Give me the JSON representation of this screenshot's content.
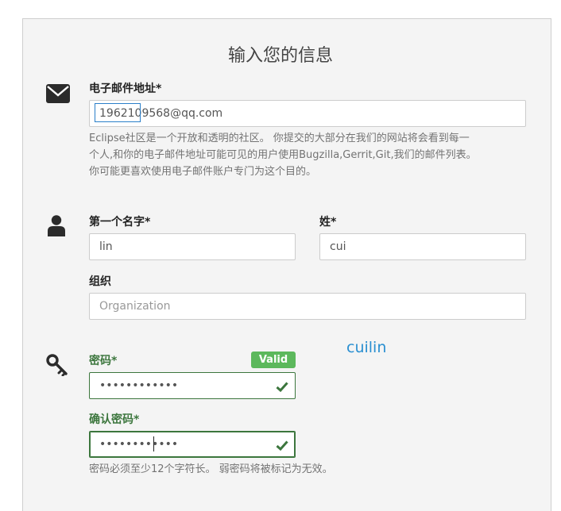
{
  "form": {
    "title": "输入您的信息",
    "email": {
      "label": "电子邮件地址*",
      "value": "1962109568@qq.com",
      "help": [
        "Eclipse社区是一个开放和透明的社区。 你提交的大部分在我们的网站将会看到每一",
        "个人,和你的电子邮件地址可能可见的用户使用Bugzilla,Gerrit,Git,我们的邮件列表。",
        "你可能更喜欢使用电子邮件账户专门为这个目的。"
      ]
    },
    "first_name": {
      "label": "第一个名字*",
      "value": "lin"
    },
    "last_name": {
      "label": "姓*",
      "value": "cui"
    },
    "organization": {
      "label": "组织",
      "placeholder": "Organization"
    },
    "password": {
      "label": "密码*",
      "value": "••••••••••••",
      "badge": "Valid"
    },
    "confirm_password": {
      "label": "确认密码*",
      "value": "••••••••••••"
    },
    "password_help": "密码必须至少12个字符长。 弱密码将被标记为无效。"
  },
  "overlay_text": "cuilin",
  "colors": {
    "valid": "#3c763d",
    "badge": "#5cb85c",
    "overlay": "#2a8fd1"
  },
  "icons": [
    "envelope-icon",
    "user-icon",
    "key-icon",
    "check-icon"
  ]
}
